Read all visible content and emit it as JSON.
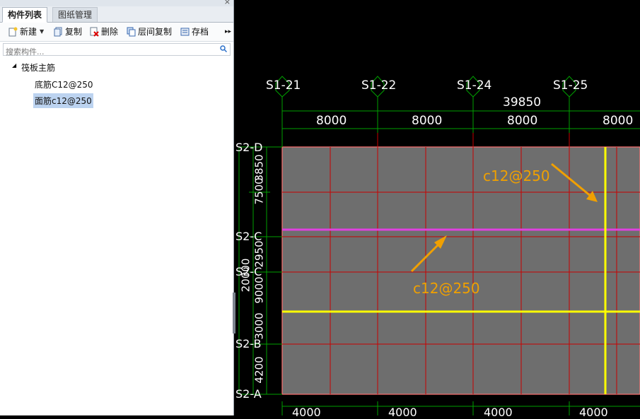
{
  "panel": {
    "tabs": [
      "构件列表",
      "图纸管理"
    ],
    "close_glyph": "×",
    "toolbar": {
      "new": "新建",
      "copy": "复制",
      "delete": "删除",
      "floor_copy": "层间复制",
      "save": "存档"
    },
    "search": {
      "placeholder": "搜索构件..."
    },
    "tree": {
      "root": "筏板主筋",
      "children": [
        "底筋C12@250",
        "面筋c12@250"
      ],
      "selected_index": 1
    }
  },
  "cad": {
    "axes_top": [
      "S1-21",
      "S1-22",
      "S1-24",
      "S1-25"
    ],
    "total_dim": "39850",
    "top_dims": [
      "8000",
      "8000",
      "8000",
      "8000"
    ],
    "axes_left": [
      "S2-D",
      "S2-C",
      "S2-C",
      "S2-B",
      "S2-A"
    ],
    "left_dims_inner": [
      "3850",
      "2950",
      "3000",
      "4200"
    ],
    "left_dims_outer": [
      "7500",
      "9000"
    ],
    "left_overall": "20000",
    "bottom_dims": [
      "4000",
      "4000",
      "4000",
      "4000"
    ],
    "annotations": [
      "c12@250",
      "c12@250"
    ],
    "colors": {
      "background": "#000000",
      "slab": "#6e6e6e",
      "grid": "#d00000",
      "dimension": "#00aa00",
      "axis_text": "#ffffff",
      "top_rebar": "#e040e0",
      "bottom_rebar": "#ffff00",
      "annotation": "#f0a000"
    }
  }
}
